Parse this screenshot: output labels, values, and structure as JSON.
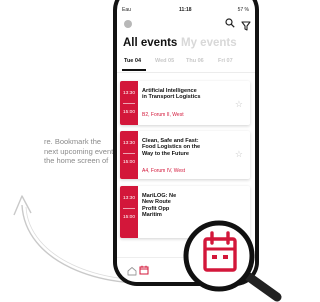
{
  "caption": {
    "lines": [
      "re. Bookmark the",
      "next upcoming events",
      "the home screen of"
    ]
  },
  "status_bar": {
    "carrier": "Eau",
    "time": "11:18",
    "battery": "57 %"
  },
  "header": {
    "all_events_label": "All events",
    "my_events_label": "My events"
  },
  "days": [
    {
      "label": "Tue 04",
      "active": true
    },
    {
      "label": "Wed 05",
      "active": false
    },
    {
      "label": "Thu 06",
      "active": false
    },
    {
      "label": "Fri 07",
      "active": false
    }
  ],
  "events": [
    {
      "start": "13:30",
      "end": "15:00",
      "title_lines": [
        "Artificial Intelligence",
        "in Transport Logistics"
      ],
      "location": "B2, Forum II, West"
    },
    {
      "start": "13:30",
      "end": "15:00",
      "title_lines": [
        "Clean, Safe and Fast:",
        "Food Logistics on the",
        "Way to the Future"
      ],
      "location": "A4, Forum IV, West"
    },
    {
      "start": "13:30",
      "end": "15:00",
      "title_lines": [
        "MariLOG: Ne",
        "New Route",
        "Profit Opp",
        "Maritim"
      ],
      "location": ""
    }
  ],
  "icons": {
    "search": "search-icon",
    "filter": "filter-icon",
    "star": "star-icon",
    "home": "home-icon",
    "calendar": "calendar-icon",
    "magnifier": "magnifier-icon"
  },
  "colors": {
    "accent": "#d3173a",
    "phone_frame": "#121212",
    "caption_text": "#8a8a8a"
  }
}
